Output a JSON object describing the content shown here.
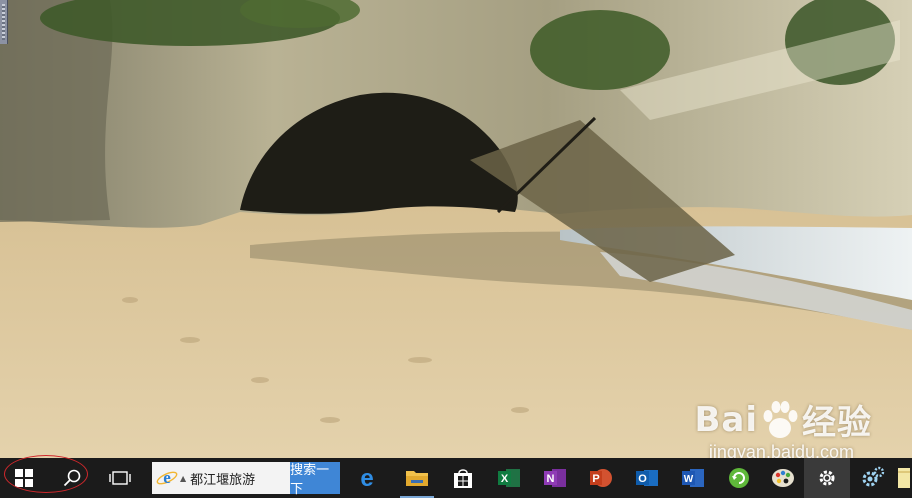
{
  "taskbar": {
    "search_box": {
      "value": "都江堰旅游",
      "button_label": "搜索一下"
    },
    "pinned_apps": [
      {
        "name": "Microsoft Edge",
        "icon": "edge-icon"
      },
      {
        "name": "File Explorer",
        "icon": "folder-icon"
      },
      {
        "name": "Store",
        "icon": "store-icon"
      },
      {
        "name": "Excel",
        "icon": "excel-icon"
      },
      {
        "name": "OneNote",
        "icon": "onenote-icon"
      },
      {
        "name": "PowerPoint",
        "icon": "powerpoint-icon"
      },
      {
        "name": "Outlook",
        "icon": "outlook-icon"
      },
      {
        "name": "Word",
        "icon": "word-icon"
      },
      {
        "name": "Refresh",
        "icon": "refresh-icon"
      },
      {
        "name": "Paint",
        "icon": "paint-icon"
      },
      {
        "name": "Settings",
        "icon": "gear-icon"
      },
      {
        "name": "Settings tool",
        "icon": "gears-icon"
      },
      {
        "name": "Notes",
        "icon": "notes-icon"
      }
    ]
  },
  "watermark": {
    "brand": "Bai",
    "brand_suffix": "经验",
    "url": "jingyan.baidu.com"
  },
  "colors": {
    "taskbar_bg": "#1b1b1b",
    "search_button": "#3f86d6",
    "start_highlight": "#d0282c"
  }
}
